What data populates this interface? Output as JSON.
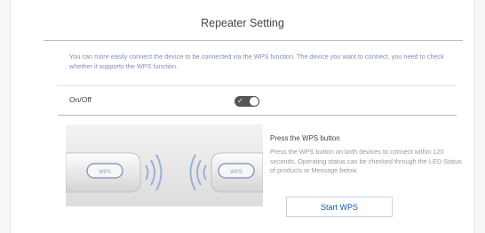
{
  "page": {
    "title": "Repeater Setting",
    "description": "You can more easily connect the device to be connected via the WPS function. The device you want to connect, you need to check whether it supports the WPS function."
  },
  "onoff": {
    "label": "On/Off",
    "checked": true,
    "check_glyph": "✓"
  },
  "wps": {
    "illustration_label_left": "WPS",
    "illustration_label_right": "WPS",
    "title": "Press the WPS button",
    "text": "Press the WPS button on both devices to connect within 120 seconds. Operating status can be checked through the LED Status of products or Message below.",
    "button_label": "Start WPS"
  },
  "colors": {
    "accent": "#1a56b8",
    "description_text": "#7f8fb2",
    "toggle_on": "#555555"
  }
}
